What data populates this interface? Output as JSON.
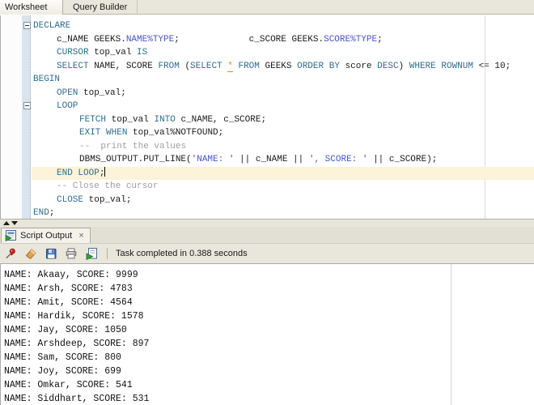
{
  "editor_tabs": {
    "tabs": [
      {
        "label": "Worksheet",
        "active": true
      },
      {
        "label": "Query Builder",
        "active": false
      }
    ]
  },
  "editor": {
    "lines": [
      {
        "indent": 0,
        "fold": true,
        "segments": [
          {
            "t": "DECLARE",
            "s": "kw"
          }
        ]
      },
      {
        "indent": 1,
        "segments": [
          {
            "t": "c_NAME GEEKS.",
            "s": "id"
          },
          {
            "t": "NAME%TYPE",
            "s": "lit"
          },
          {
            "t": ";             c_SCORE GEEKS.",
            "s": "id"
          },
          {
            "t": "SCORE%TYPE",
            "s": "lit"
          },
          {
            "t": ";",
            "s": "id"
          }
        ]
      },
      {
        "indent": 1,
        "segments": [
          {
            "t": "CURSOR",
            "s": "kw"
          },
          {
            "t": " top_val ",
            "s": "id"
          },
          {
            "t": "IS",
            "s": "kw"
          }
        ]
      },
      {
        "indent": 1,
        "segments": [
          {
            "t": "SELECT",
            "s": "kw"
          },
          {
            "t": " NAME, SCORE ",
            "s": "id"
          },
          {
            "t": "FROM",
            "s": "kw"
          },
          {
            "t": " (",
            "s": "id"
          },
          {
            "t": "SELECT",
            "s": "kw"
          },
          {
            "t": " ",
            "s": "id"
          },
          {
            "t": "*",
            "s": "warn"
          },
          {
            "t": " ",
            "s": "id"
          },
          {
            "t": "FROM",
            "s": "kw"
          },
          {
            "t": " GEEKS ",
            "s": "id"
          },
          {
            "t": "ORDER BY",
            "s": "kw"
          },
          {
            "t": " score ",
            "s": "id"
          },
          {
            "t": "DESC",
            "s": "kw"
          },
          {
            "t": ") ",
            "s": "id"
          },
          {
            "t": "WHERE",
            "s": "kw"
          },
          {
            "t": " ",
            "s": "id"
          },
          {
            "t": "ROWNUM",
            "s": "kw"
          },
          {
            "t": " <= 10;",
            "s": "id"
          }
        ]
      },
      {
        "indent": 0,
        "segments": [
          {
            "t": "BEGIN",
            "s": "kw"
          }
        ]
      },
      {
        "indent": 1,
        "segments": [
          {
            "t": "OPEN",
            "s": "kw"
          },
          {
            "t": " top_val;",
            "s": "id"
          }
        ]
      },
      {
        "indent": 1,
        "fold": true,
        "segments": [
          {
            "t": "LOOP",
            "s": "kw"
          }
        ]
      },
      {
        "indent": 2,
        "segments": [
          {
            "t": "FETCH",
            "s": "kw"
          },
          {
            "t": " top_val ",
            "s": "id"
          },
          {
            "t": "INTO",
            "s": "kw"
          },
          {
            "t": " c_NAME, c_SCORE;",
            "s": "id"
          }
        ]
      },
      {
        "indent": 2,
        "segments": [
          {
            "t": "EXIT",
            "s": "kw"
          },
          {
            "t": " ",
            "s": "id"
          },
          {
            "t": "WHEN",
            "s": "kw"
          },
          {
            "t": " top_val%NOTFOUND;",
            "s": "id"
          }
        ]
      },
      {
        "indent": 2,
        "segments": [
          {
            "t": "--  print the values",
            "s": "com"
          }
        ]
      },
      {
        "indent": 2,
        "segments": [
          {
            "t": "DBMS_OUTPUT.PUT_LINE(",
            "s": "id"
          },
          {
            "t": "'NAME: '",
            "s": "lit"
          },
          {
            "t": " || c_NAME || ",
            "s": "id"
          },
          {
            "t": "', SCORE: '",
            "s": "lit"
          },
          {
            "t": " || c_SCORE);",
            "s": "id"
          }
        ]
      },
      {
        "indent": 1,
        "highlight": true,
        "caret": true,
        "segments": [
          {
            "t": "END LOOP",
            "s": "kw"
          },
          {
            "t": ";",
            "s": "id"
          }
        ]
      },
      {
        "indent": 1,
        "segments": [
          {
            "t": "-- Close the cursor",
            "s": "com"
          }
        ]
      },
      {
        "indent": 1,
        "segments": [
          {
            "t": "CLOSE",
            "s": "kw"
          },
          {
            "t": " top_val;",
            "s": "id"
          }
        ]
      },
      {
        "indent": 0,
        "segments": [
          {
            "t": "END",
            "s": "kw"
          },
          {
            "t": ";",
            "s": "id"
          }
        ]
      }
    ]
  },
  "output_panel": {
    "tab": {
      "label": "Script Output",
      "close": "×",
      "icon": "script-output-icon"
    },
    "toolbar": {
      "icons": [
        "pushpin-icon",
        "eraser-icon",
        "save-icon",
        "print-icon",
        "run-script-icon"
      ],
      "status": "Task completed in 0.388 seconds"
    },
    "lines": [
      "NAME: Akaay, SCORE: 9999",
      "NAME: Arsh, SCORE: 4783",
      "NAME: Amit, SCORE: 4564",
      "NAME: Hardik, SCORE: 1578",
      "NAME: Jay, SCORE: 1050",
      "NAME: Arshdeep, SCORE: 897",
      "NAME: Sam, SCORE: 800",
      "NAME: Joy, SCORE: 699",
      "NAME: Omkar, SCORE: 541",
      "NAME: Siddhart, SCORE: 531"
    ]
  },
  "colors": {
    "keyword": "#2d6e8c",
    "literal": "#4655c8",
    "comment": "#9e9e9e",
    "warning": "#e0861f",
    "highlight": "#fcf3d8"
  }
}
